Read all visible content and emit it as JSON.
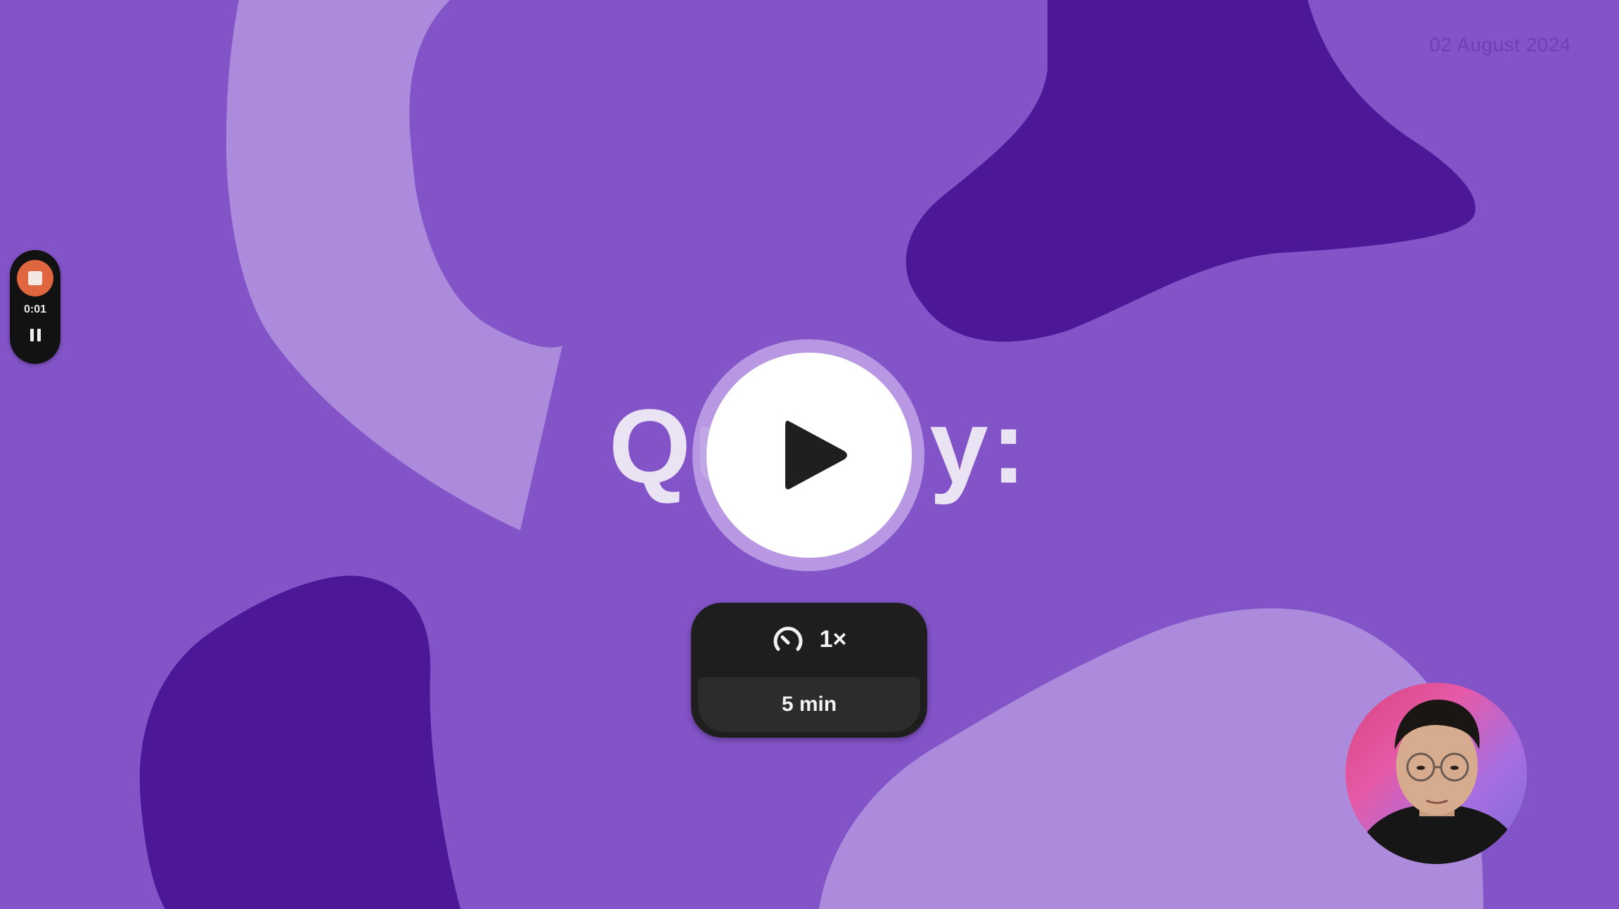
{
  "slide": {
    "date": "02 August 2024",
    "title_partial_left": "Qu",
    "title_partial_right": "y:"
  },
  "recorder": {
    "elapsed": "0:01",
    "stop_icon": "stop-icon",
    "pause_icon": "pause-icon"
  },
  "player": {
    "play_icon": "play-icon",
    "speed_icon": "gauge-icon",
    "speed": "1×",
    "duration": "5 min"
  },
  "colors": {
    "background": "#8353c8",
    "dark_blob": "#4d1898",
    "light_blob": "#ac8bdc",
    "record_red": "#e0663f"
  }
}
